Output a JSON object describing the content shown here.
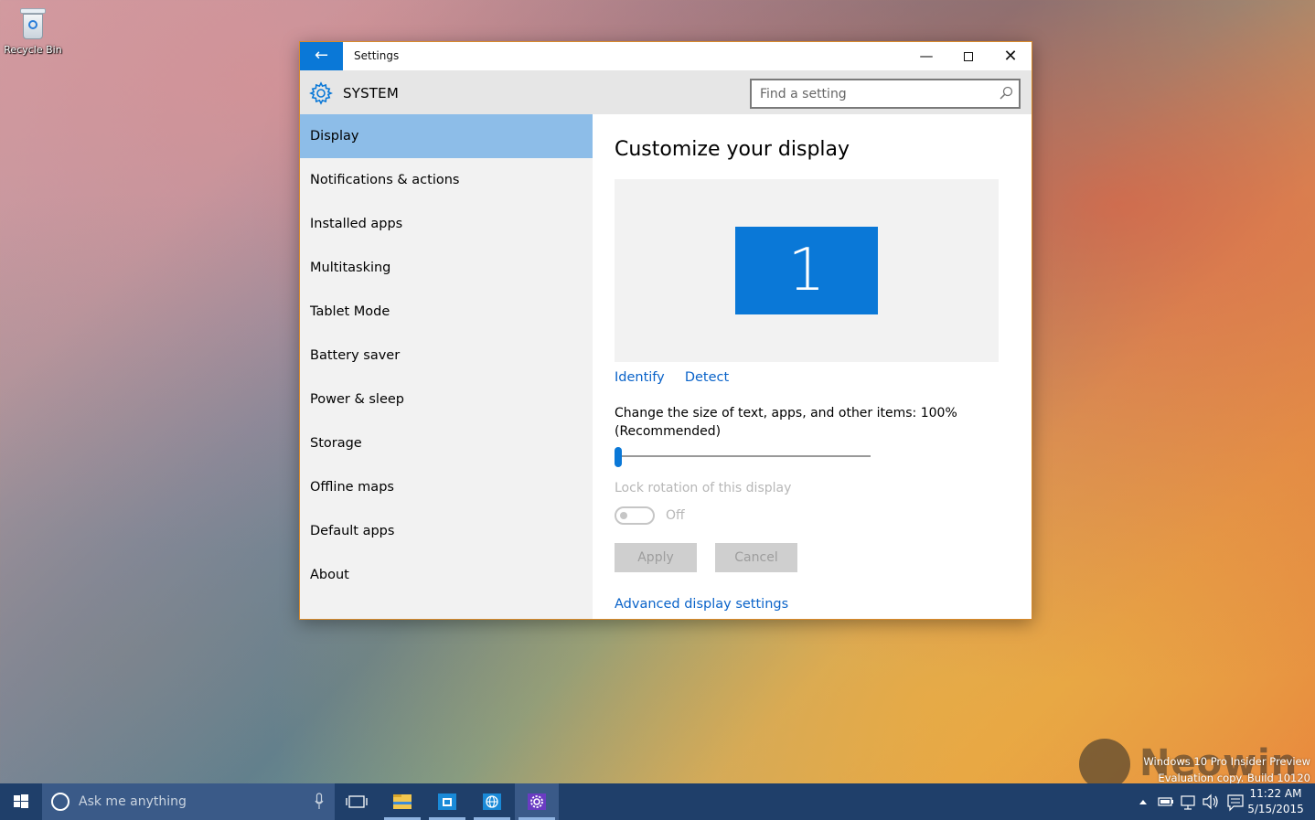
{
  "desktop": {
    "recycle_bin_label": "Recycle Bin",
    "watermark_line1": "Windows 10 Pro Insider Preview",
    "watermark_line2": "Evaluation copy. Build 10120",
    "neowin_logo_text": "Neowin"
  },
  "window": {
    "title": "Settings",
    "back_icon": "arrow-left-icon",
    "controls": [
      "minimize",
      "maximize",
      "close"
    ]
  },
  "header": {
    "section": "SYSTEM",
    "icon": "gear-icon",
    "search_placeholder": "Find a setting"
  },
  "sidebar": {
    "items": [
      {
        "label": "Display",
        "active": true
      },
      {
        "label": "Notifications & actions",
        "active": false
      },
      {
        "label": "Installed apps",
        "active": false
      },
      {
        "label": "Multitasking",
        "active": false
      },
      {
        "label": "Tablet Mode",
        "active": false
      },
      {
        "label": "Battery saver",
        "active": false
      },
      {
        "label": "Power & sleep",
        "active": false
      },
      {
        "label": "Storage",
        "active": false
      },
      {
        "label": "Offline maps",
        "active": false
      },
      {
        "label": "Default apps",
        "active": false
      },
      {
        "label": "About",
        "active": false
      }
    ]
  },
  "content": {
    "title": "Customize your display",
    "monitor_number": "1",
    "identify_link": "Identify",
    "detect_link": "Detect",
    "scale_label": "Change the size of text, apps, and other items: 100% (Recommended)",
    "scale_fraction": 0.0,
    "lock_rotation_label": "Lock rotation of this display",
    "lock_rotation_state": "Off",
    "apply_label": "Apply",
    "cancel_label": "Cancel",
    "advanced_link": "Advanced display settings"
  },
  "taskbar": {
    "search_placeholder": "Ask me anything",
    "apps": [
      "task-view-icon",
      "file-explorer-icon",
      "store-icon",
      "browser-icon",
      "settings-icon"
    ],
    "tray_icons": [
      "chevron-up-icon",
      "battery-icon",
      "network-icon",
      "volume-icon",
      "action-center-icon"
    ],
    "time": "11:22 AM",
    "date": "5/15/2015"
  },
  "colors": {
    "accent": "#0a78d7",
    "selected_nav": "#8dbde8",
    "link": "#0a63c9",
    "taskbar": "#1f3f6a"
  }
}
